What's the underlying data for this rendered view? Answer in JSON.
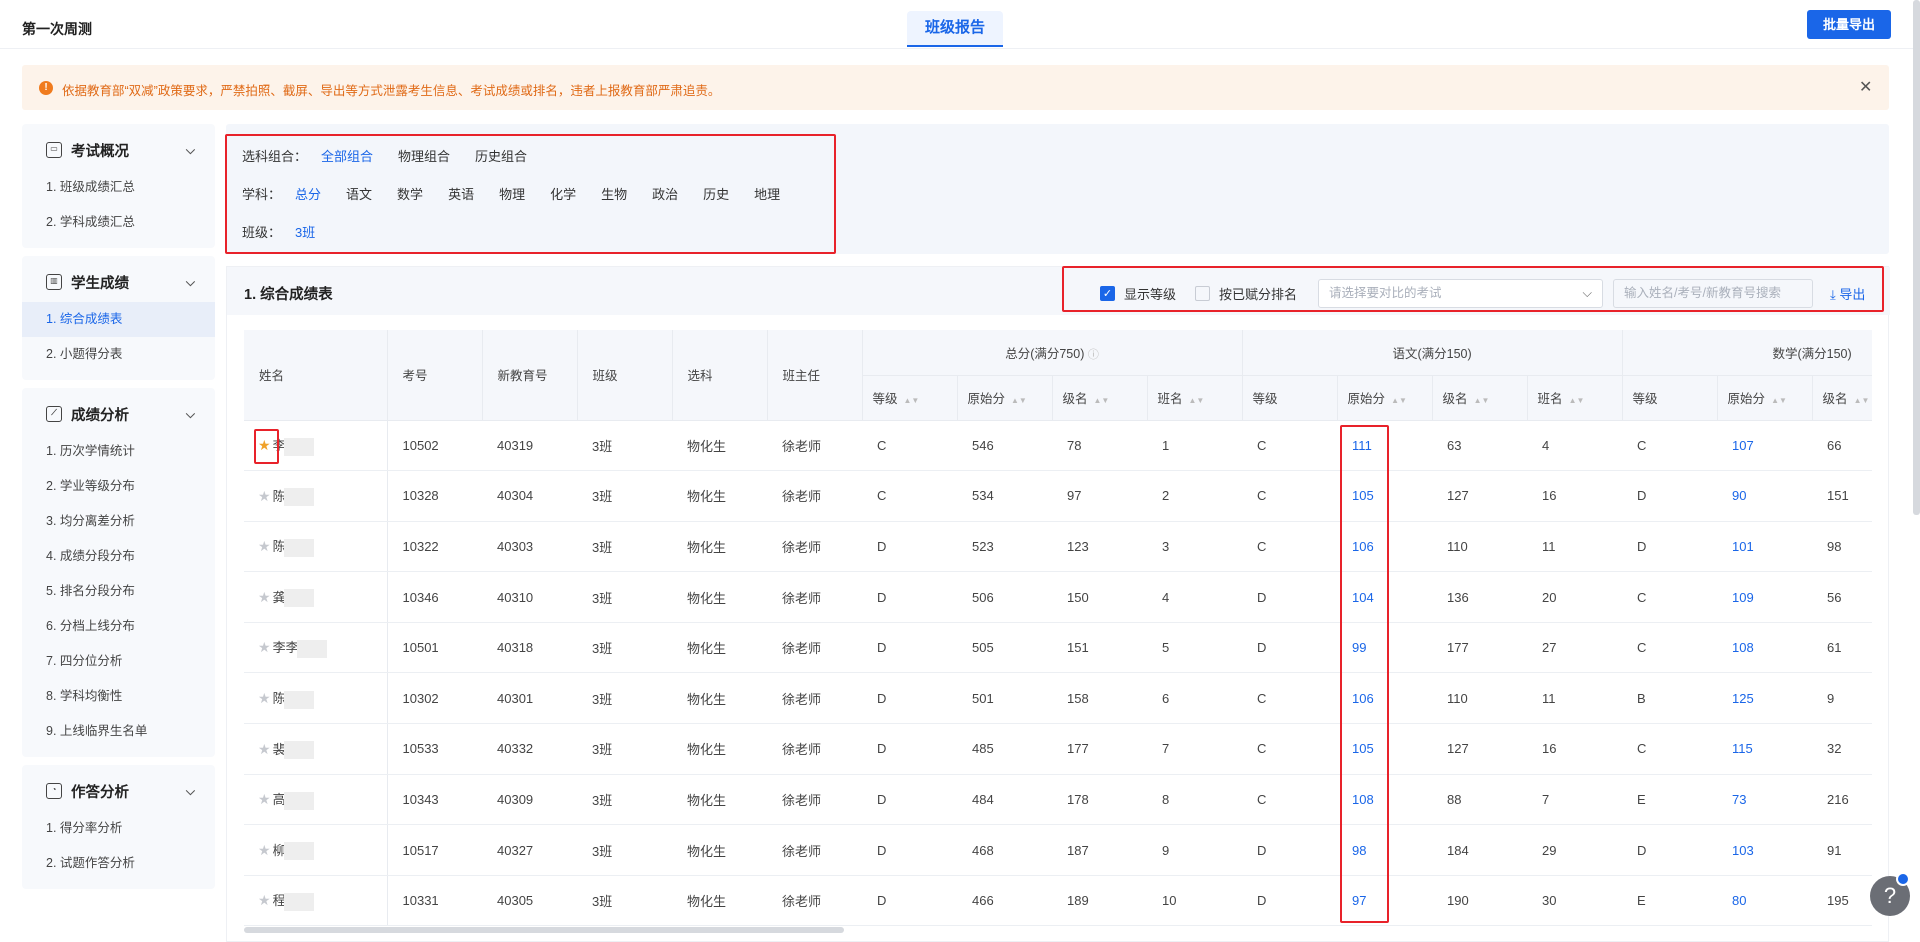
{
  "header": {
    "title": "第一次周测",
    "tab": "班级报告",
    "batch_export": "批量导出"
  },
  "alert": {
    "icon": "!",
    "text": "依据教育部“双减”政策要求，严禁拍照、截屏、导出等方式泄露考生信息、考试成绩或排名，违者上报教育部严肃追责。",
    "close": "✕"
  },
  "sidebar": {
    "groups": [
      {
        "title": "考试概况",
        "icon": "exam-icon",
        "items": [
          "1. 班级成绩汇总",
          "2. 学科成绩汇总"
        ]
      },
      {
        "title": "学生成绩",
        "icon": "bar-chart-icon",
        "items": [
          "1. 综合成绩表",
          "2. 小题得分表"
        ]
      },
      {
        "title": "成绩分析",
        "icon": "line-chart-icon",
        "items": [
          "1. 历次学情统计",
          "2. 学业等级分布",
          "3. 均分离差分析",
          "4. 成绩分段分布",
          "5. 排名分段分布",
          "6. 分档上线分布",
          "7. 四分位分析",
          "8. 学科均衡性",
          "9. 上线临界生名单"
        ]
      },
      {
        "title": "作答分析",
        "icon": "pie-icon",
        "items": [
          "1. 得分率分析",
          "2. 试题作答分析"
        ]
      }
    ]
  },
  "filter": {
    "combo_label": "选科组合：",
    "combos": [
      "全部组合",
      "物理组合",
      "历史组合"
    ],
    "subject_label": "学科：",
    "subjects": [
      "总分",
      "语文",
      "数学",
      "英语",
      "物理",
      "化学",
      "生物",
      "政治",
      "历史",
      "地理"
    ],
    "class_label": "班级：",
    "class": "3班"
  },
  "section": {
    "title": "1. 综合成绩表",
    "show_grade": "显示等级",
    "rank_by_assigned": "按已赋分排名",
    "compare_placeholder": "请选择要对比的考试",
    "search_placeholder": "输入姓名/考号/新教育号搜索",
    "export": "导出"
  },
  "table": {
    "cols": {
      "name": "姓名",
      "exam_no": "考号",
      "edu_no": "新教育号",
      "class": "班级",
      "subject": "选科",
      "teacher": "班主任"
    },
    "groups": {
      "total": "总分(满分750)",
      "chinese": "语文(满分150)",
      "math": "数学(满分150)"
    },
    "sub": {
      "grade": "等级",
      "raw": "原始分",
      "grade_rank": "级名",
      "class_rank": "班名"
    },
    "rows": [
      {
        "name": "李",
        "exam": "10502",
        "edu": "40319",
        "cls": "3班",
        "sub": "物化生",
        "t": "徐老师",
        "tg": "C",
        "tr": "546",
        "tgr": "78",
        "tcr": "1",
        "cg": "C",
        "cr": "111",
        "cgr": "63",
        "ccr": "4",
        "mg": "C",
        "mr": "107",
        "mgr": "66"
      },
      {
        "name": "陈",
        "exam": "10328",
        "edu": "40304",
        "cls": "3班",
        "sub": "物化生",
        "t": "徐老师",
        "tg": "C",
        "tr": "534",
        "tgr": "97",
        "tcr": "2",
        "cg": "C",
        "cr": "105",
        "cgr": "127",
        "ccr": "16",
        "mg": "D",
        "mr": "90",
        "mgr": "151"
      },
      {
        "name": "陈",
        "exam": "10322",
        "edu": "40303",
        "cls": "3班",
        "sub": "物化生",
        "t": "徐老师",
        "tg": "D",
        "tr": "523",
        "tgr": "123",
        "tcr": "3",
        "cg": "C",
        "cr": "106",
        "cgr": "110",
        "ccr": "11",
        "mg": "D",
        "mr": "101",
        "mgr": "98"
      },
      {
        "name": "龚",
        "exam": "10346",
        "edu": "40310",
        "cls": "3班",
        "sub": "物化生",
        "t": "徐老师",
        "tg": "D",
        "tr": "506",
        "tgr": "150",
        "tcr": "4",
        "cg": "D",
        "cr": "104",
        "cgr": "136",
        "ccr": "20",
        "mg": "C",
        "mr": "109",
        "mgr": "56"
      },
      {
        "name": "李李",
        "exam": "10501",
        "edu": "40318",
        "cls": "3班",
        "sub": "物化生",
        "t": "徐老师",
        "tg": "D",
        "tr": "505",
        "tgr": "151",
        "tcr": "5",
        "cg": "D",
        "cr": "99",
        "cgr": "177",
        "ccr": "27",
        "mg": "C",
        "mr": "108",
        "mgr": "61"
      },
      {
        "name": "陈",
        "exam": "10302",
        "edu": "40301",
        "cls": "3班",
        "sub": "物化生",
        "t": "徐老师",
        "tg": "D",
        "tr": "501",
        "tgr": "158",
        "tcr": "6",
        "cg": "C",
        "cr": "106",
        "cgr": "110",
        "ccr": "11",
        "mg": "B",
        "mr": "125",
        "mgr": "9"
      },
      {
        "name": "裴",
        "exam": "10533",
        "edu": "40332",
        "cls": "3班",
        "sub": "物化生",
        "t": "徐老师",
        "tg": "D",
        "tr": "485",
        "tgr": "177",
        "tcr": "7",
        "cg": "C",
        "cr": "105",
        "cgr": "127",
        "ccr": "16",
        "mg": "C",
        "mr": "115",
        "mgr": "32"
      },
      {
        "name": "高",
        "exam": "10343",
        "edu": "40309",
        "cls": "3班",
        "sub": "物化生",
        "t": "徐老师",
        "tg": "D",
        "tr": "484",
        "tgr": "178",
        "tcr": "8",
        "cg": "C",
        "cr": "108",
        "cgr": "88",
        "ccr": "7",
        "mg": "E",
        "mr": "73",
        "mgr": "216"
      },
      {
        "name": "柳",
        "exam": "10517",
        "edu": "40327",
        "cls": "3班",
        "sub": "物化生",
        "t": "徐老师",
        "tg": "D",
        "tr": "468",
        "tgr": "187",
        "tcr": "9",
        "cg": "D",
        "cr": "98",
        "cgr": "184",
        "ccr": "29",
        "mg": "D",
        "mr": "103",
        "mgr": "91"
      },
      {
        "name": "程",
        "exam": "10331",
        "edu": "40305",
        "cls": "3班",
        "sub": "物化生",
        "t": "徐老师",
        "tg": "D",
        "tr": "466",
        "tgr": "189",
        "tcr": "10",
        "cg": "D",
        "cr": "97",
        "cgr": "190",
        "ccr": "30",
        "mg": "E",
        "mr": "80",
        "mgr": "195"
      }
    ]
  },
  "help": "?"
}
